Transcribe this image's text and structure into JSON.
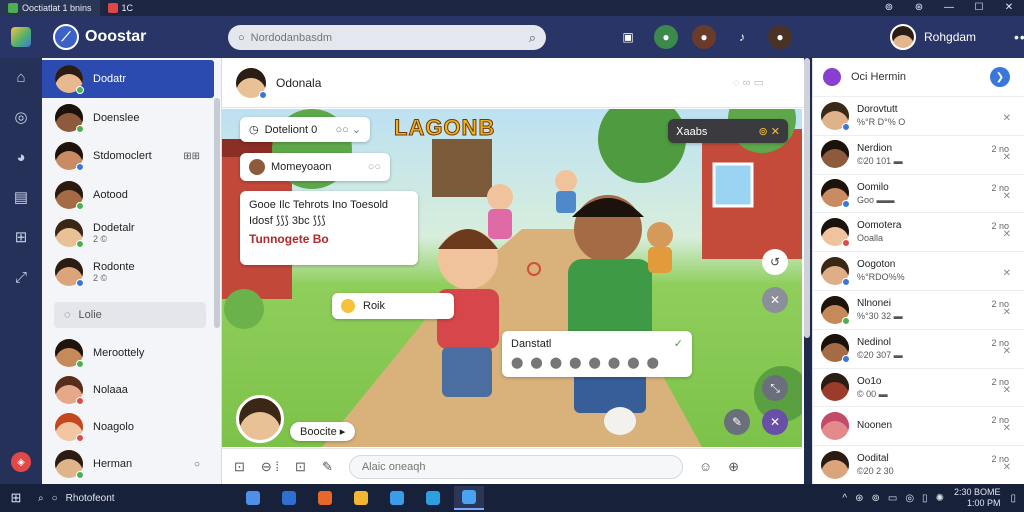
{
  "titlebar": {
    "tabs": [
      {
        "label": "Ooctiatlat  1 bnins",
        "color": "#4caf50"
      },
      {
        "label": "1C",
        "color": "#e04646"
      }
    ],
    "controls": [
      "⊚",
      "⊛",
      "—",
      "☐",
      "✕"
    ]
  },
  "header": {
    "brand_icon": "app-cube-icon",
    "app_name": "Ooostar",
    "search_placeholder": "Nordodanbasdm",
    "user_name": "Rohgdam",
    "more_icon": "•••",
    "icons": [
      {
        "name": "badge-icon",
        "glyph": "▣",
        "bg": "#283566",
        "dot": false
      },
      {
        "name": "avatar-icon-1",
        "glyph": "●",
        "bg": "#3b8a4b",
        "dot": false
      },
      {
        "name": "avatar-icon-2",
        "glyph": "●",
        "bg": "#6a3b2a",
        "dot": false
      },
      {
        "name": "bell-icon",
        "glyph": "♪",
        "bg": "#283566",
        "dot": true
      },
      {
        "name": "avatar-icon-3",
        "glyph": "●",
        "bg": "#4a3326",
        "dot": true
      }
    ]
  },
  "rail": [
    {
      "name": "home-icon",
      "glyph": "⌂"
    },
    {
      "name": "compass-icon",
      "glyph": "◎"
    },
    {
      "name": "people-icon",
      "glyph": "◕"
    },
    {
      "name": "bag-icon",
      "glyph": "▤"
    },
    {
      "name": "gamepad-icon",
      "glyph": "⊞"
    },
    {
      "name": "expand-icon",
      "glyph": "⤢"
    }
  ],
  "rail_bottom_icon": "shield-icon",
  "contacts": [
    {
      "name": "Dodatr",
      "sub": "",
      "act": "",
      "skin": "#e8b88f",
      "hair": "#2a1d14",
      "status": "#4caf50",
      "selected": true
    },
    {
      "name": "Doenslee",
      "sub": "",
      "act": "",
      "skin": "#8d5a3b",
      "hair": "#1b120c",
      "status": "#4caf50",
      "selected": false
    },
    {
      "name": "Stdomoclert",
      "sub": "",
      "act": "⊞⊞",
      "skin": "#c98c62",
      "hair": "#1e130b",
      "status": "#3a77d9",
      "selected": false
    },
    {
      "name": "Aotood",
      "sub": "",
      "act": "",
      "skin": "#a46b45",
      "hair": "#2a1a10",
      "status": "#4caf50",
      "selected": false
    },
    {
      "name": "Dodetalr",
      "sub": "2 ©",
      "act": "",
      "skin": "#e9c196",
      "hair": "#3a2616",
      "status": "#4caf50",
      "selected": false
    },
    {
      "name": "Rodonte",
      "sub": "2 ©",
      "act": "",
      "skin": "#dba47a",
      "hair": "#2b1c11",
      "status": "#3a77d9",
      "selected": false
    }
  ],
  "contact_separator": "Lolie",
  "contacts_lower": [
    {
      "name": "Meroottely",
      "sub": "",
      "act": "",
      "skin": "#c68a5a",
      "hair": "#1e140c",
      "status": "#4caf50"
    },
    {
      "name": "Nolaaa",
      "sub": "",
      "act": "",
      "skin": "#e5a889",
      "hair": "#5a2c1b",
      "status": "#e34848"
    },
    {
      "name": "Noagolo",
      "sub": "",
      "act": "",
      "skin": "#f1c6a0",
      "hair": "#c4471d",
      "status": "#e34848"
    },
    {
      "name": "Herman",
      "sub": "",
      "act": "○",
      "skin": "#e0b48a",
      "hair": "#2a1c12",
      "status": "#4caf50"
    }
  ],
  "chat": {
    "partner_name": "Odonala",
    "head_ops": "◌ ∞ ▭",
    "game_title": "LAGONB",
    "bubble_select": "Doteliont 0",
    "bubble_select_ops": "○○ ⌄",
    "bubble_user": "Momeyoaon",
    "bubble_main_line1": "Gooe Ilc Tehrots Ino Toesold",
    "bubble_main_line2": "Idosf ⟆⟆⟆ 3bc ⟆⟆⟆",
    "bubble_main_line3": "Tunnogete  Bo",
    "bubble_small": "Roik",
    "bubble_reactions_title": "Danstatl",
    "bubble_reactions_icons": "⬤ ⬤ ⬤  ⬤ ⬤ ⬤  ⬤ ⬤",
    "game_hud": "Ⅹaabs",
    "game_hud_ops": "⊚ ✕",
    "player_label": "Boocite",
    "player_label_ops": "▸",
    "input_placeholder": "Alaic oneaqh",
    "foot_icons": [
      "paperclip-icon",
      "gif-icon",
      "sticker-icon",
      "brush-icon"
    ],
    "foot_glyphs": [
      "⊡",
      "⊖ ⁞",
      "⊡",
      "✎"
    ],
    "send_icon": "⊕",
    "emoji_icon": "☺",
    "fab_glyphs": [
      "↺",
      "✕",
      "⤡",
      "✎",
      "✕"
    ]
  },
  "right_panel": {
    "title": "Oci Hermin",
    "go_icon": "❯",
    "items": [
      {
        "name": "Dorovtutt",
        "sub": "%°R D°% O",
        "time": "",
        "skin": "#e0b28c",
        "hair": "#3a2818",
        "status": "#3a77d9"
      },
      {
        "name": "Nerdion",
        "sub": "©20 101 ▬",
        "time": "2 no",
        "skin": "#8d5a3b",
        "hair": "#1b120c",
        "status": ""
      },
      {
        "name": "Oomilo",
        "sub": "Goo ▬▬",
        "time": "2 no",
        "skin": "#c98c62",
        "hair": "#1e130b",
        "status": "#3a77d9"
      },
      {
        "name": "Oomotera",
        "sub": "Ooalla",
        "time": "2 no",
        "skin": "#f0c29d",
        "hair": "#1a120c",
        "status": "#e34848"
      },
      {
        "name": "Oogoton",
        "sub": "%°RDO%%",
        "time": "",
        "skin": "#dfae87",
        "hair": "#3b2715",
        "status": "#3a77d9"
      },
      {
        "name": "Nlnonei",
        "sub": "%°30 32 ▬",
        "time": "2 no",
        "skin": "#c68a5a",
        "hair": "#1e140c",
        "status": "#4caf50"
      },
      {
        "name": "Nedinol",
        "sub": "©20 307 ▬",
        "time": "2 no",
        "skin": "#a46b45",
        "hair": "#1a110a",
        "status": "#3a77d9"
      },
      {
        "name": "Oo1o",
        "sub": "© 00 ▬",
        "time": "2 no",
        "skin": "#9b3b2a",
        "hair": "#2a1d14",
        "status": ""
      },
      {
        "name": "Noonen",
        "sub": "",
        "time": "2 no",
        "skin": "#e58a8a",
        "hair": "#c24b6a",
        "status": ""
      },
      {
        "name": "Oodital",
        "sub": "©20 2 30",
        "time": "2 no",
        "skin": "#dba47a",
        "hair": "#2b1c11",
        "status": ""
      }
    ]
  },
  "taskbar": {
    "start_icon": "windows-icon",
    "search_icon": "search-icon",
    "search_text": "Rhotofeont",
    "apps": [
      "#4f8fe8",
      "#2f6fd1",
      "#e8672a",
      "#f2b632",
      "#3a9de8",
      "#2d9fe0",
      "#4aa3f0"
    ],
    "tray_glyphs": [
      "^",
      "⊛",
      "⊚",
      "▭",
      "◎",
      "▯",
      "✺"
    ],
    "clock_time": "2:30 BOME",
    "clock_date": "1:00 PM"
  }
}
